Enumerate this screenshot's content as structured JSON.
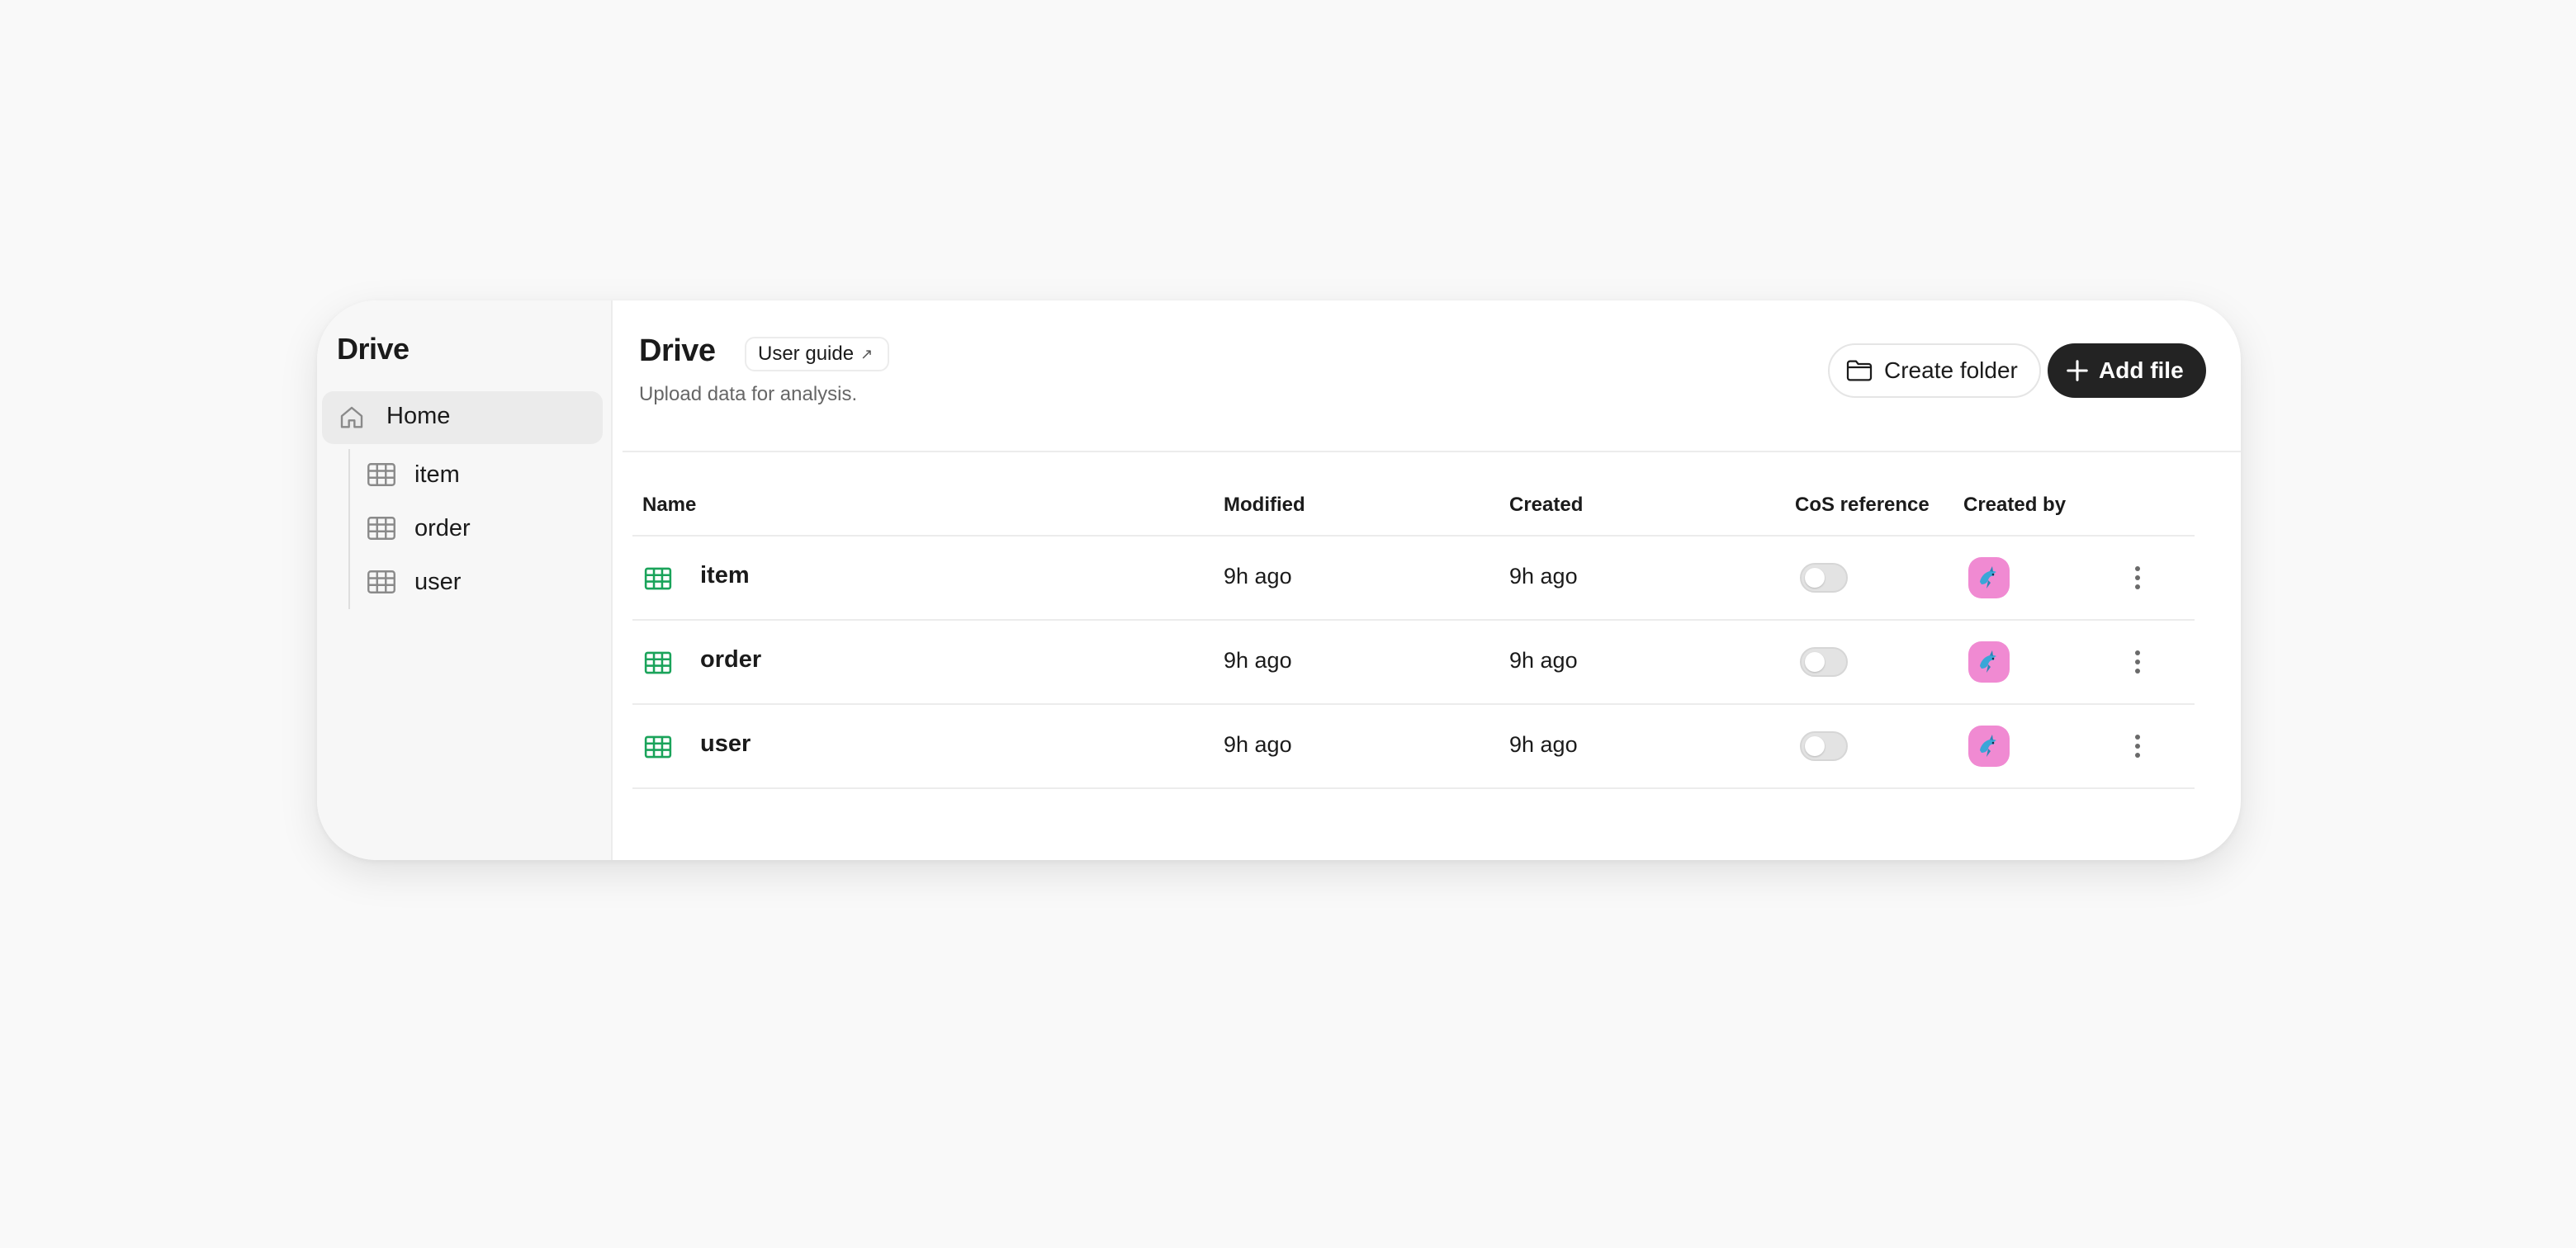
{
  "sidebar": {
    "title": "Drive",
    "home": {
      "label": "Home",
      "icon": "home-icon"
    },
    "items": [
      {
        "label": "item",
        "icon": "table-icon"
      },
      {
        "label": "order",
        "icon": "table-icon"
      },
      {
        "label": "user",
        "icon": "table-icon"
      }
    ]
  },
  "header": {
    "title": "Drive",
    "guide_label": "User guide",
    "subtitle": "Upload data for analysis.",
    "create_folder_label": "Create folder",
    "add_file_label": "Add file"
  },
  "table": {
    "columns": {
      "name": "Name",
      "modified": "Modified",
      "created": "Created",
      "cos_reference": "CoS reference",
      "created_by": "Created by"
    },
    "rows": [
      {
        "name": "item",
        "modified": "9h ago",
        "created": "9h ago",
        "cos_reference": false,
        "icon": "sheet-icon"
      },
      {
        "name": "order",
        "modified": "9h ago",
        "created": "9h ago",
        "cos_reference": false,
        "icon": "sheet-icon"
      },
      {
        "name": "user",
        "modified": "9h ago",
        "created": "9h ago",
        "cos_reference": false,
        "icon": "sheet-icon"
      }
    ]
  },
  "colors": {
    "accent_dark": "#232323",
    "sheet_icon_green": "#1aa35a",
    "avatar_bg": "#f08ad2",
    "background": "#f9f9f9"
  }
}
